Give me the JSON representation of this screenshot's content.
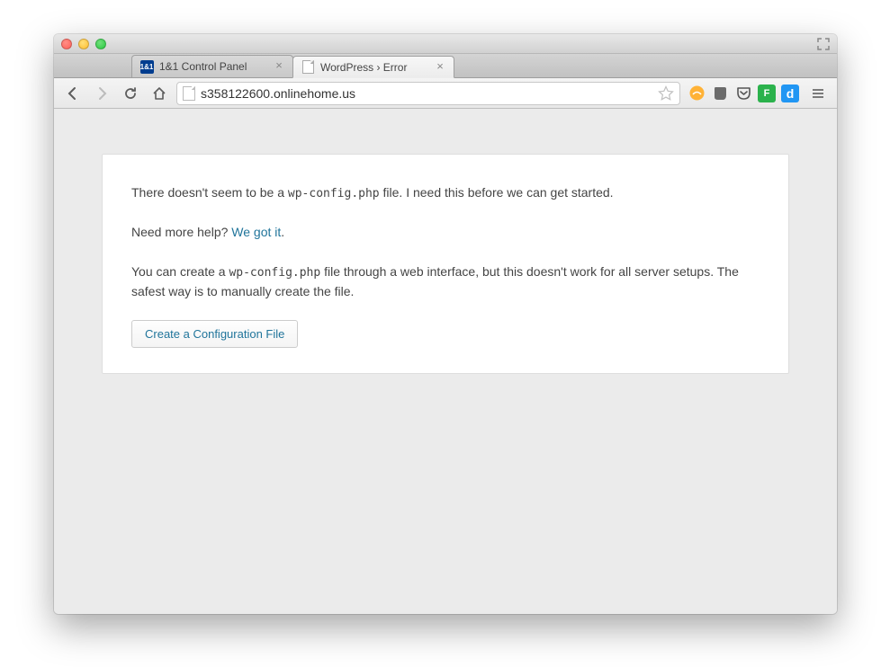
{
  "tabs": [
    {
      "title": "1&1 Control Panel",
      "active": false
    },
    {
      "title": "WordPress › Error",
      "active": true
    }
  ],
  "address_bar": {
    "url": "s358122600.onlinehome.us"
  },
  "extensions": {
    "hover": {
      "bg": "#ffb236",
      "glyph": "☁"
    },
    "evernote": {
      "bg": "#6fb536",
      "glyph": "✎"
    },
    "pocket": {
      "bg": "#444",
      "glyph": "◡"
    },
    "feedly": {
      "bg": "#2bb24c",
      "glyph": "F"
    },
    "diigo": {
      "bg": "#2196f3",
      "glyph": "d"
    }
  },
  "page": {
    "p1_a": "There doesn't seem to be a ",
    "p1_code": "wp-config.php",
    "p1_b": " file. I need this before we can get started.",
    "p2_a": "Need more help? ",
    "p2_link": "We got it",
    "p2_b": ".",
    "p3_a": "You can create a ",
    "p3_code": "wp-config.php",
    "p3_b": " file through a web interface, but this doesn't work for all server setups. The safest way is to manually create the file.",
    "button": "Create a Configuration File"
  }
}
